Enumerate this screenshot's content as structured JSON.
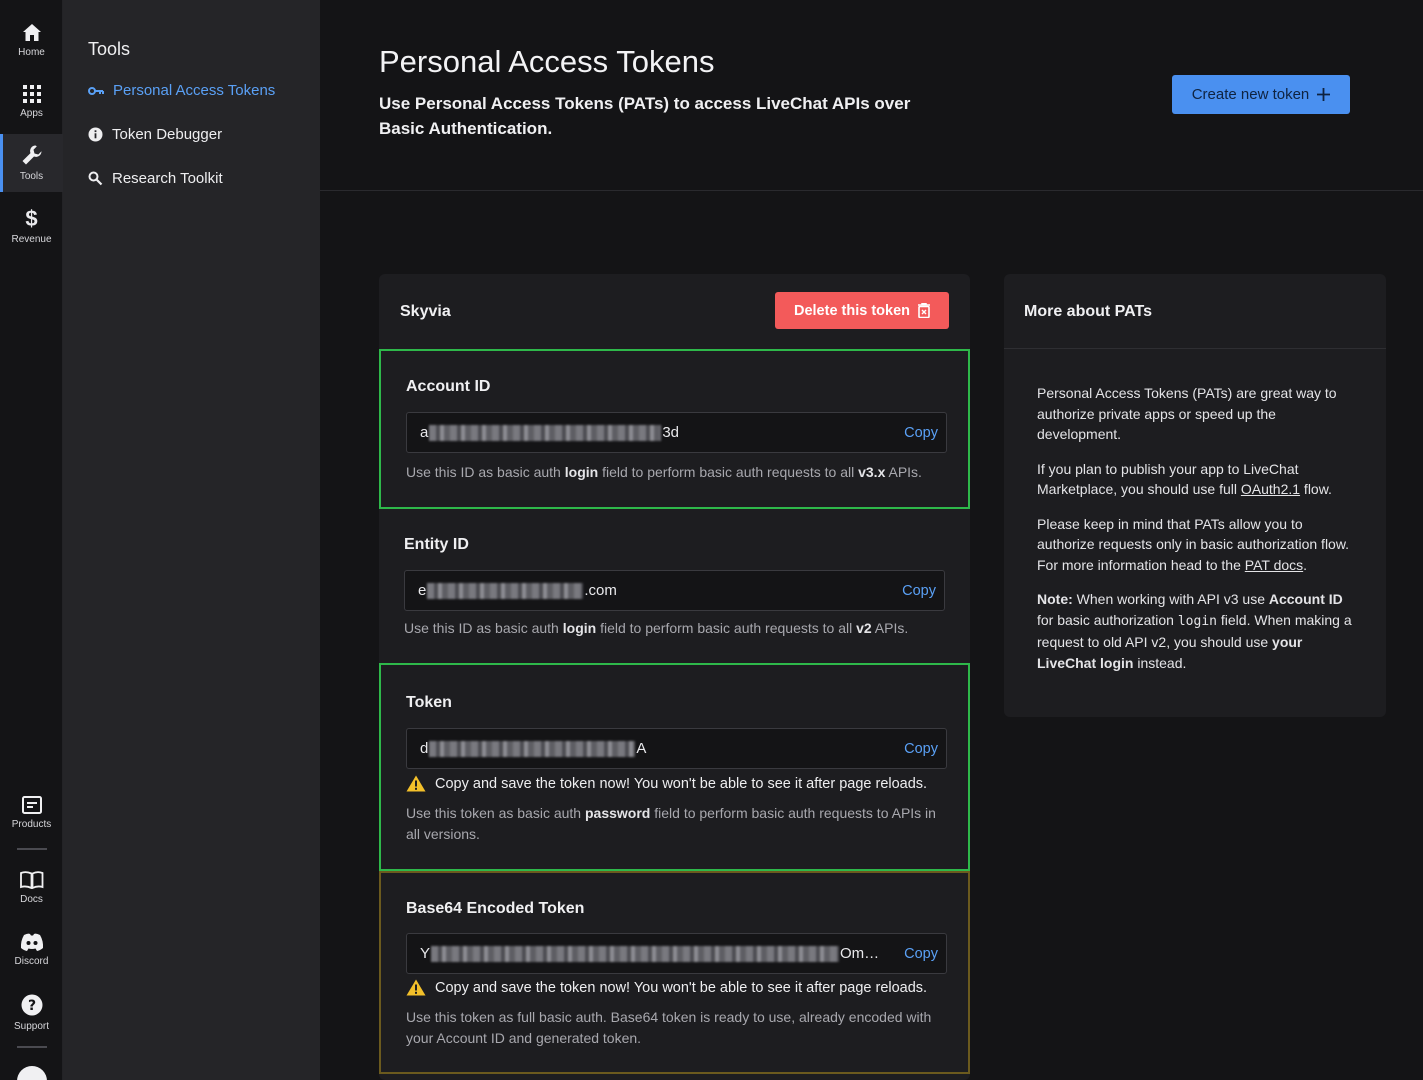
{
  "rail": {
    "items": [
      {
        "label": "Home",
        "icon": "home-icon"
      },
      {
        "label": "Apps",
        "icon": "grid-icon"
      },
      {
        "label": "Tools",
        "icon": "wrench-icon",
        "active": true
      },
      {
        "label": "Revenue",
        "icon": "dollar-icon"
      }
    ],
    "bottom_items": [
      {
        "label": "Products",
        "icon": "products-icon"
      },
      {
        "label": "Docs",
        "icon": "book-icon"
      },
      {
        "label": "Discord",
        "icon": "discord-icon"
      },
      {
        "label": "Support",
        "icon": "help-icon"
      }
    ]
  },
  "sidebar": {
    "title": "Tools",
    "items": [
      {
        "label": "Personal Access Tokens",
        "icon": "key-icon",
        "active": true
      },
      {
        "label": "Token Debugger",
        "icon": "info-icon"
      },
      {
        "label": "Research Toolkit",
        "icon": "search-icon"
      }
    ]
  },
  "header": {
    "title": "Personal Access Tokens",
    "subtitle": "Use Personal Access Tokens (PATs) to access LiveChat APIs over Basic Authentication.",
    "create_label": "Create new token",
    "create_icon": "plus-icon"
  },
  "token_card": {
    "name": "Skyvia",
    "delete_label": "Delete this token",
    "copy_label": "Copy",
    "warning": "Copy and save the token now! You won't be able to see it after page reloads.",
    "account": {
      "label": "Account ID",
      "prefix": "a",
      "suffix": "3d",
      "help_pre": "Use this ID as basic auth ",
      "help_bold": "login",
      "help_mid": " field to perform basic auth requests to all ",
      "help_bold2": "v3.x",
      "help_post": " APIs."
    },
    "entity": {
      "label": "Entity ID",
      "prefix": "e",
      "suffix": ".com",
      "help_pre": "Use this ID as basic auth ",
      "help_bold": "login",
      "help_mid": " field to perform basic auth requests to all ",
      "help_bold2": "v2",
      "help_post": " APIs."
    },
    "token": {
      "label": "Token",
      "prefix": "d",
      "suffix": "A",
      "help_pre": "Use this token as basic auth ",
      "help_bold": "password",
      "help_post": " field to perform basic auth requests to APIs in all versions."
    },
    "base64": {
      "label": "Base64 Encoded Token",
      "prefix": "Y",
      "suffix": "Om…",
      "help": "Use this token as full basic auth. Base64 token is ready to use, already encoded with your Account ID and generated token."
    }
  },
  "info": {
    "title": "More about PATs",
    "p1": "Personal Access Tokens (PATs) are great way to authorize private apps or speed up the development.",
    "p2_pre": "If you plan to publish your app to LiveChat Marketplace, you should use full ",
    "p2_link": "OAuth2.1",
    "p2_post": " flow.",
    "p3_pre": "Please keep in mind that PATs allow you to authorize requests only in basic authorization flow. For more information head to the ",
    "p3_link": "PAT docs",
    "p3_post": ".",
    "note_label": "Note:",
    "note_1": " When working with API v3 use ",
    "note_b1": "Account ID",
    "note_2": " for basic authorization ",
    "note_code": "login",
    "note_3": " field. When making a request to old API v2, you should use ",
    "note_b2": "your LiveChat login",
    "note_4": " instead."
  },
  "colors": {
    "accent": "#4a90f0",
    "danger": "#f35a5a",
    "highlight_green": "#2eb84a",
    "highlight_yellow": "#6b5a1e"
  }
}
